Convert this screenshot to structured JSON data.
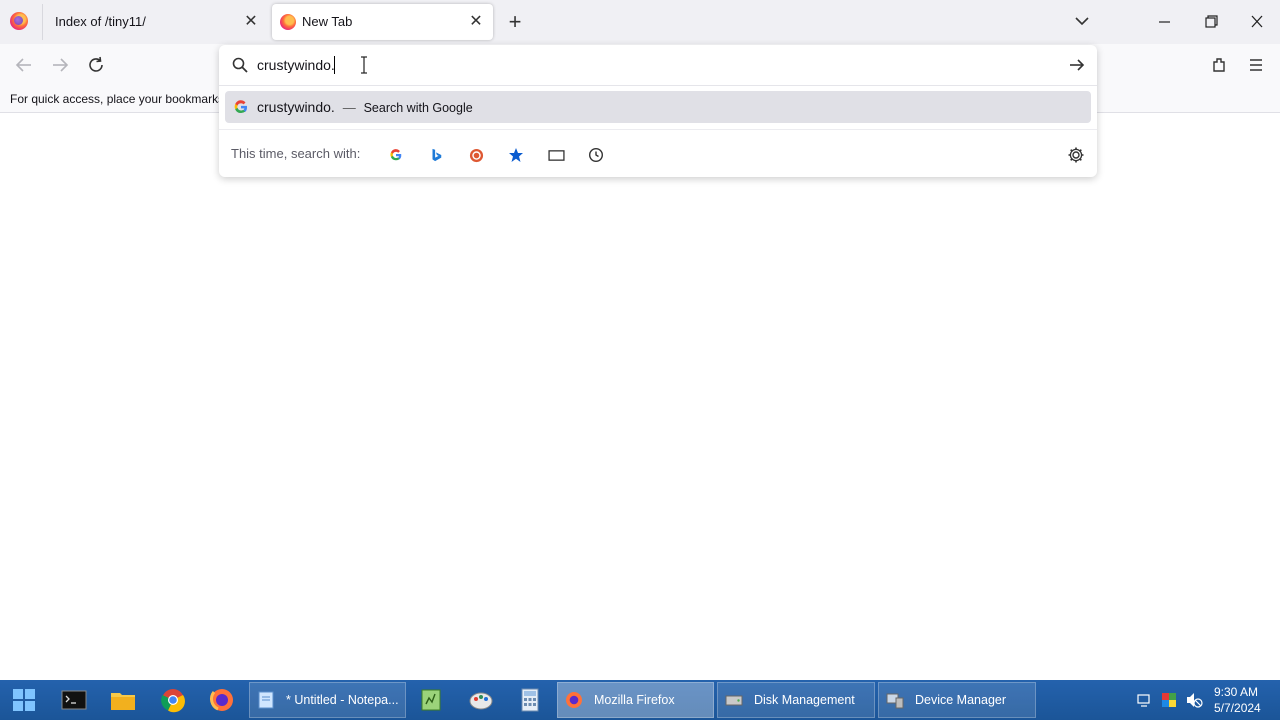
{
  "browser": {
    "tabs": [
      {
        "label": "Index of /tiny11/",
        "active": false
      },
      {
        "label": "New Tab",
        "active": true
      }
    ],
    "close_glyph": "✕",
    "new_tab_glyph": "+",
    "bookmarks_hint": "For quick access, place your bookmarks"
  },
  "urlbar": {
    "value": "crustywindo.",
    "suggestion": {
      "text": "crustywindo.",
      "separator": "—",
      "action": "Search with Google"
    },
    "oneoff_label": "This time, search with:",
    "oneoff_icons": [
      "google-icon",
      "bing-icon",
      "duckduckgo-icon",
      "bookmarks-star-icon",
      "tabs-icon",
      "history-icon"
    ]
  },
  "taskbar": {
    "tasks": [
      {
        "label": "* Untitled - Notepa...",
        "active": false
      },
      {
        "label": "Mozilla Firefox",
        "active": true
      },
      {
        "label": "Disk Management",
        "active": false
      },
      {
        "label": "Device Manager",
        "active": false
      }
    ],
    "clock": {
      "time": "9:30 AM",
      "date": "5/7/2024"
    }
  },
  "colors": {
    "taskbar": "#1f5fa8",
    "suggestion_highlight": "#e0e0e6",
    "accent": "#0061e0"
  }
}
